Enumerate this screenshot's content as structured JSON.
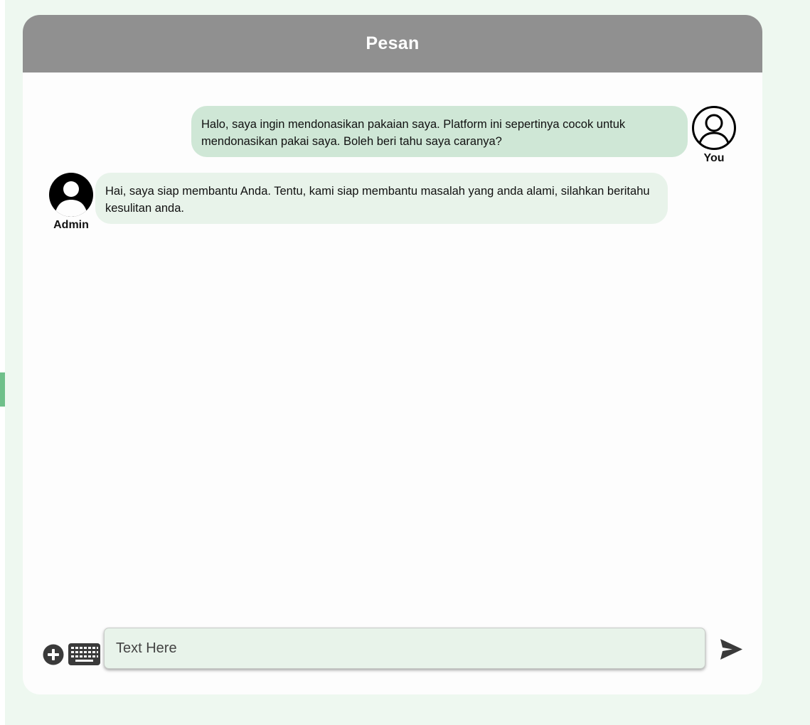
{
  "chat": {
    "title": "Pesan"
  },
  "messages": [
    {
      "direction": "outgoing",
      "sender": "You",
      "text": "Halo, saya ingin mendonasikan pakaian saya. Platform ini sepertinya cocok untuk mendonasikan pakai saya. Boleh beri tahu saya caranya?",
      "avatar_icon": "user-circle-outline-icon"
    },
    {
      "direction": "incoming",
      "sender": "Admin",
      "text": "Hai, saya siap membantu Anda. Tentu, kami siap membantu masalah yang anda alami, silahkan beritahu kesulitan anda.",
      "avatar_icon": "user-circle-filled-icon"
    }
  ],
  "composer": {
    "placeholder": "Text Here",
    "value": "",
    "attach_icon": "plus-circle-icon",
    "keyboard_icon": "keyboard-icon",
    "send_icon": "send-icon"
  },
  "colors": {
    "header_bg": "#909090",
    "page_bg": "#eef8f0",
    "outgoing_bubble": "#cfe7d6",
    "incoming_bubble": "#e8f3ea",
    "input_bg": "#e8f3ea",
    "icon_dark": "#3a3a3a"
  }
}
